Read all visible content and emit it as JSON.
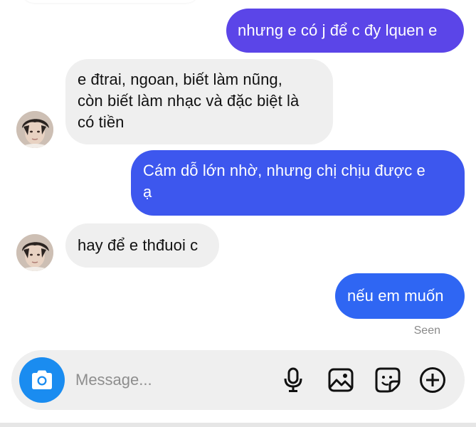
{
  "messages": [
    {
      "id": "m1",
      "direction": "outgoing",
      "text": "nhưng e có j để c đy lquen e"
    },
    {
      "id": "m2",
      "direction": "incoming",
      "lines": [
        "e đtrai, ngoan, biết làm nũng,",
        "còn biết làm nhạc và đặc biệt là",
        "có tiền"
      ]
    },
    {
      "id": "m3",
      "direction": "outgoing",
      "lines": [
        "Cám dỗ lớn nhờ, nhưng chị chịu được e",
        "ạ"
      ]
    },
    {
      "id": "m4",
      "direction": "incoming",
      "text": "hay để e thđuoi c"
    },
    {
      "id": "m5",
      "direction": "outgoing",
      "text": "nếu em muốn"
    }
  ],
  "status": {
    "seen": "Seen"
  },
  "composer": {
    "placeholder": "Message...",
    "icons": [
      "camera-icon",
      "microphone-icon",
      "image-icon",
      "sticker-icon",
      "plus-icon"
    ]
  },
  "colors": {
    "outgoing_top": "#5b45e8",
    "outgoing_mid": "#3d57ee",
    "outgoing_bottom": "#2f66f3",
    "incoming": "#efefef",
    "accent": "#1a8cf0"
  }
}
